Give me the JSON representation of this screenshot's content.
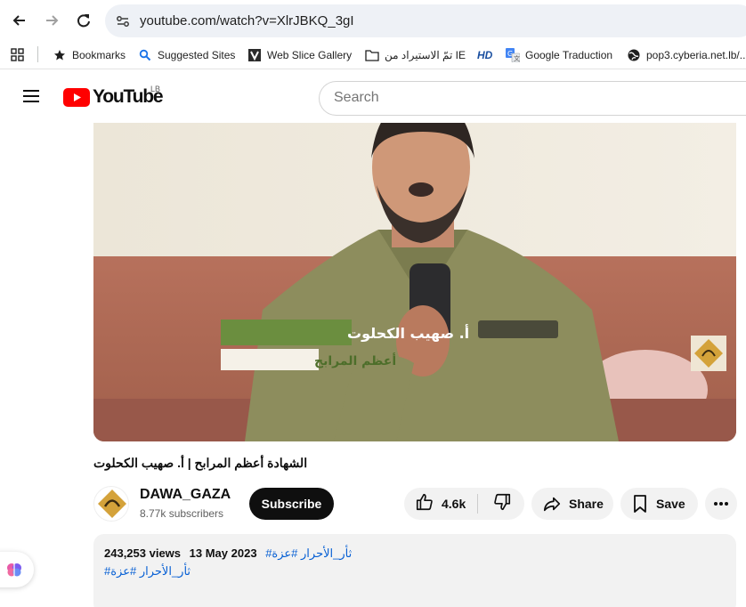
{
  "browser": {
    "url": "youtube.com/watch?v=XlrJBKQ_3gI",
    "bookmarks": [
      {
        "label": "Bookmarks",
        "icon": "star-icon"
      },
      {
        "label": "Suggested Sites",
        "icon": "search-icon"
      },
      {
        "label": "Web Slice Gallery",
        "icon": "web-slice-icon"
      },
      {
        "label": "تمّ الاستيراد من IE",
        "icon": "folder-icon"
      },
      {
        "label": "",
        "icon": "hd-icon"
      },
      {
        "label": "Google Traduction",
        "icon": "translate-icon"
      },
      {
        "label": "pop3.cyberia.net.lb/...",
        "icon": "globe-icon"
      }
    ]
  },
  "youtube": {
    "logo_text": "YouTube",
    "country_code": "LB",
    "search_placeholder": "Search"
  },
  "video": {
    "overlay_name": "أ. صهيب الكحلوت",
    "overlay_subtitle": "أعظم المرابح",
    "title": "الشهادة أعظم المرابح | أ. صهيب الكحلوت"
  },
  "channel": {
    "name": "DAWA_GAZA",
    "subscribers": "8.77k subscribers",
    "subscribe_label": "Subscribe"
  },
  "actions": {
    "like_count": "4.6k",
    "share_label": "Share",
    "save_label": "Save"
  },
  "description": {
    "views": "243,253 views",
    "date": "13 May 2023",
    "hashtags_line1": "#ثأر_الأحرار #عزة",
    "hashtags_line2": "#ثأر_الأحرار #عزة"
  },
  "colors": {
    "yt_red": "#ff0000",
    "link_blue": "#065fd4",
    "overlay_green": "#6b8e3f"
  }
}
